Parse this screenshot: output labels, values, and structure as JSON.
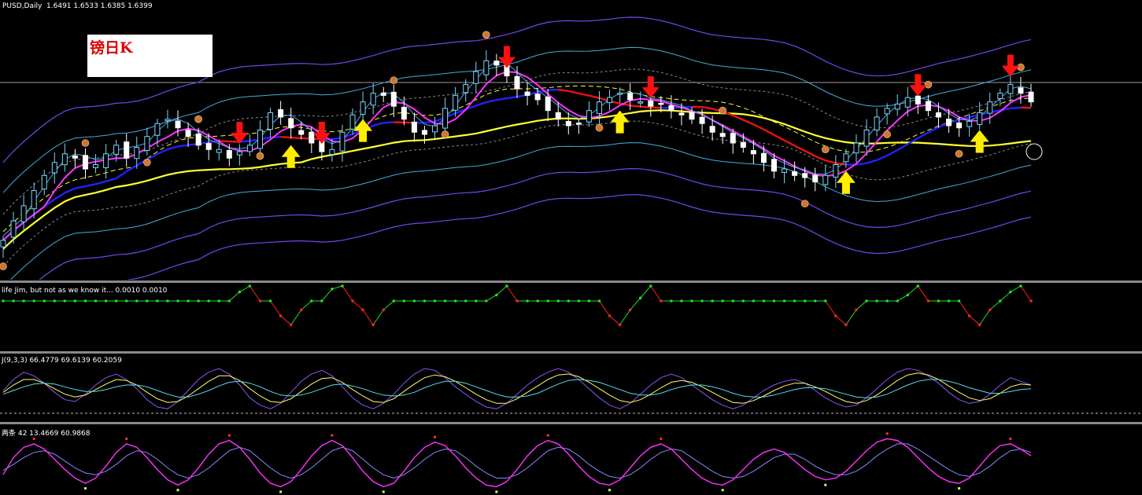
{
  "header": {
    "symbol_timeframe": "PUSD,Daily",
    "ohlc": "1.6491 1.6533 1.6385 1.6399"
  },
  "legend": {
    "text": "镑日K"
  },
  "indicators": [
    {
      "id": "signal",
      "label": "life Jim, but not as we know it...  0.0010 0.0010"
    },
    {
      "id": "kdj",
      "label": "J(9,3,3) 66.4779 69.6139 60.2059"
    },
    {
      "id": "osc",
      "label": "两条 42  13.4669 60.9868"
    }
  ],
  "colors": {
    "background": "#000000",
    "bull_candle": "#7ad6ff",
    "bear_candle": "#ffffff",
    "ma_yellow": "#ffff33",
    "ma_magenta": "#ff33ff",
    "ma_blue": "#2222ff",
    "ma_red": "#ee1111",
    "band_purple": "#7744ee",
    "band_light_blue": "#44aadd",
    "band_grey": "#888888",
    "arrow_down": "#ff1010",
    "arrow_up": "#ffee00",
    "signal_flat": "#22dd22",
    "signal_drop": "#ff2222",
    "fractal": "#cc7733"
  },
  "chart_data": {
    "type": "line",
    "title": "PUSD,Daily",
    "bars": 101,
    "price_close": [
      1.588,
      1.597,
      1.604,
      1.611,
      1.618,
      1.624,
      1.628,
      1.626,
      1.621,
      1.623,
      1.628,
      1.632,
      1.626,
      1.631,
      1.636,
      1.642,
      1.644,
      1.64,
      1.636,
      1.632,
      1.63,
      1.63,
      1.626,
      1.629,
      1.632,
      1.639,
      1.647,
      1.645,
      1.64,
      1.637,
      1.633,
      1.629,
      1.63,
      1.638,
      1.646,
      1.652,
      1.656,
      1.655,
      1.65,
      1.644,
      1.638,
      1.637,
      1.641,
      1.649,
      1.655,
      1.66,
      1.666,
      1.671,
      1.669,
      1.664,
      1.658,
      1.655,
      1.653,
      1.648,
      1.644,
      1.641,
      1.642,
      1.648,
      1.652,
      1.654,
      1.656,
      1.653,
      1.652,
      1.65,
      1.651,
      1.648,
      1.646,
      1.644,
      1.642,
      1.638,
      1.636,
      1.633,
      1.631,
      1.628,
      1.624,
      1.62,
      1.621,
      1.618,
      1.617,
      1.615,
      1.618,
      1.623,
      1.628,
      1.633,
      1.639,
      1.645,
      1.649,
      1.651,
      1.654,
      1.651,
      1.648,
      1.645,
      1.641,
      1.64,
      1.643,
      1.647,
      1.652,
      1.656,
      1.66,
      1.656,
      1.652
    ],
    "signals": [
      {
        "type": "sell",
        "bar": 23
      },
      {
        "type": "sell",
        "bar": 31
      },
      {
        "type": "sell",
        "bar": 49
      },
      {
        "type": "sell",
        "bar": 63
      },
      {
        "type": "sell",
        "bar": 89
      },
      {
        "type": "sell",
        "bar": 98
      },
      {
        "type": "buy",
        "bar": 28
      },
      {
        "type": "buy",
        "bar": 35
      },
      {
        "type": "buy",
        "bar": 60
      },
      {
        "type": "buy",
        "bar": 82
      },
      {
        "type": "buy",
        "bar": 95
      }
    ],
    "signal_series": [
      0.001,
      0.001,
      0.001,
      0.001,
      0.001,
      0.001,
      0.001,
      0.001,
      0.001,
      0.001,
      0.001,
      0.001,
      0.001,
      0.001,
      0.001,
      0.001,
      0.001,
      0.001,
      0.001,
      0.001,
      0.001,
      0.001,
      0.001,
      0.0016,
      0.002,
      0.001,
      0.001,
      0.0,
      -0.0006,
      0.0004,
      0.001,
      0.001,
      0.0018,
      0.002,
      0.001,
      0.0004,
      -0.0006,
      0.0004,
      0.001,
      0.001,
      0.001,
      0.001,
      0.001,
      0.001,
      0.001,
      0.001,
      0.001,
      0.001,
      0.0014,
      0.002,
      0.001,
      0.001,
      0.001,
      0.001,
      0.001,
      0.001,
      0.001,
      0.001,
      0.001,
      0.0,
      -0.0006,
      0.0004,
      0.0012,
      0.002,
      0.001,
      0.001,
      0.001,
      0.001,
      0.001,
      0.001,
      0.001,
      0.001,
      0.001,
      0.001,
      0.001,
      0.001,
      0.001,
      0.001,
      0.001,
      0.001,
      0.001,
      0.0,
      -0.0006,
      0.0004,
      0.001,
      0.001,
      0.001,
      0.001,
      0.0014,
      0.002,
      0.001,
      0.001,
      0.001,
      0.001,
      0.0,
      -0.0006,
      0.0004,
      0.001,
      0.0016,
      0.002,
      0.001
    ],
    "kdj": {
      "J": [
        60,
        72,
        80,
        76,
        68,
        58,
        50,
        48,
        56,
        66,
        74,
        78,
        72,
        62,
        50,
        42,
        40,
        48,
        60,
        72,
        80,
        84,
        78,
        66,
        52,
        44,
        40,
        46,
        58,
        70,
        78,
        82,
        76,
        64,
        52,
        44,
        40,
        46,
        56,
        68,
        78,
        84,
        82,
        74,
        64,
        56,
        48,
        42,
        40,
        46,
        56,
        66,
        74,
        80,
        84,
        80,
        72,
        62,
        52,
        44,
        40,
        46,
        56,
        66,
        74,
        78,
        74,
        66,
        58,
        50,
        44,
        40,
        44,
        52,
        60,
        66,
        70,
        72,
        68,
        60,
        52,
        46,
        42,
        44,
        52,
        62,
        72,
        80,
        84,
        82,
        76,
        68,
        58,
        50,
        46,
        48,
        56,
        66,
        74,
        70,
        66
      ],
      "K": [
        58,
        66,
        72,
        72,
        68,
        62,
        56,
        53,
        55,
        61,
        67,
        72,
        71,
        66,
        58,
        51,
        47,
        48,
        54,
        62,
        70,
        76,
        76,
        71,
        62,
        54,
        48,
        47,
        51,
        59,
        67,
        73,
        74,
        69,
        61,
        54,
        48,
        47,
        51,
        59,
        67,
        74,
        77,
        75,
        70,
        63,
        56,
        50,
        46,
        46,
        51,
        58,
        65,
        72,
        77,
        78,
        75,
        69,
        62,
        55,
        49,
        47,
        50,
        56,
        63,
        69,
        71,
        69,
        64,
        58,
        52,
        47,
        46,
        49,
        54,
        60,
        65,
        68,
        68,
        64,
        59,
        53,
        48,
        46,
        49,
        55,
        63,
        71,
        77,
        79,
        77,
        72,
        65,
        58,
        52,
        49,
        51,
        57,
        64,
        67,
        66
      ],
      "D": [
        56,
        60,
        64,
        67,
        68,
        67,
        64,
        61,
        59,
        59,
        61,
        64,
        66,
        66,
        64,
        60,
        56,
        53,
        53,
        56,
        60,
        65,
        69,
        70,
        68,
        64,
        59,
        55,
        54,
        55,
        58,
        62,
        66,
        67,
        65,
        62,
        58,
        55,
        54,
        55,
        58,
        63,
        67,
        70,
        70,
        68,
        64,
        60,
        56,
        53,
        53,
        54,
        57,
        62,
        67,
        71,
        72,
        71,
        69,
        65,
        61,
        57,
        55,
        55,
        57,
        61,
        64,
        66,
        66,
        64,
        61,
        57,
        54,
        53,
        53,
        55,
        58,
        61,
        63,
        63,
        62,
        59,
        56,
        53,
        52,
        53,
        56,
        61,
        66,
        70,
        72,
        72,
        70,
        67,
        63,
        60,
        57,
        57,
        59,
        61,
        62
      ]
    },
    "osc": {
      "line1": [
        40,
        60,
        72,
        76,
        70,
        58,
        46,
        36,
        30,
        36,
        50,
        66,
        76,
        72,
        60,
        46,
        34,
        28,
        34,
        48,
        64,
        76,
        80,
        72,
        58,
        42,
        30,
        26,
        32,
        46,
        62,
        74,
        80,
        74,
        60,
        44,
        32,
        26,
        30,
        44,
        60,
        72,
        78,
        74,
        62,
        48,
        36,
        28,
        26,
        32,
        46,
        62,
        74,
        80,
        76,
        64,
        50,
        38,
        30,
        28,
        34,
        48,
        62,
        72,
        76,
        70,
        58,
        46,
        36,
        30,
        28,
        34,
        46,
        58,
        66,
        70,
        66,
        56,
        46,
        38,
        34,
        36,
        44,
        56,
        68,
        78,
        82,
        80,
        72,
        60,
        48,
        38,
        32,
        30,
        36,
        50,
        64,
        74,
        76,
        70,
        62
      ],
      "line2": [
        45,
        52,
        60,
        66,
        68,
        64,
        56,
        48,
        42,
        40,
        44,
        52,
        62,
        68,
        66,
        58,
        48,
        40,
        36,
        40,
        48,
        58,
        68,
        72,
        68,
        58,
        48,
        40,
        36,
        40,
        48,
        58,
        68,
        72,
        68,
        58,
        48,
        40,
        36,
        40,
        48,
        58,
        66,
        70,
        68,
        60,
        50,
        42,
        36,
        36,
        40,
        48,
        58,
        68,
        72,
        70,
        62,
        52,
        44,
        38,
        36,
        40,
        48,
        58,
        66,
        70,
        68,
        60,
        52,
        44,
        38,
        36,
        38,
        44,
        52,
        60,
        64,
        64,
        58,
        50,
        44,
        40,
        40,
        44,
        52,
        62,
        70,
        76,
        76,
        70,
        62,
        54,
        46,
        40,
        38,
        42,
        50,
        60,
        68,
        70,
        66
      ]
    }
  }
}
